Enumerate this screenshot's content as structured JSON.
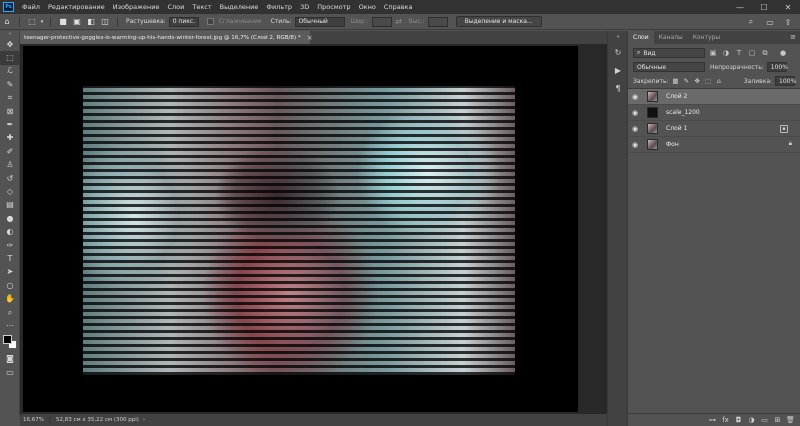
{
  "app": {
    "logo": "Ps"
  },
  "menu": {
    "items": [
      "Файл",
      "Редактирование",
      "Изображение",
      "Слои",
      "Текст",
      "Выделение",
      "Фильтр",
      "3D",
      "Просмотр",
      "Окно",
      "Справка"
    ]
  },
  "window_controls": {
    "minimize": "—",
    "maximize": "☐",
    "close": "✕"
  },
  "options": {
    "feather_label": "Растушевка:",
    "feather_value": "0 пикс.",
    "antialias_label": "Сглаживание",
    "style_label": "Стиль:",
    "style_value": "Обычный",
    "width_label": "Шир.:",
    "height_label": "Выс.:",
    "select_mask_button": "Выделение и маска..."
  },
  "document": {
    "tab_title": "teenager-protective-goggles-is-warming-up-his-hands-winter-forest.jpg @ 16,7% (Слой 2, RGB/8) *",
    "close": "×"
  },
  "status": {
    "zoom": "16,67%",
    "info": "52,83 см x 35,22 см (300 ppi)",
    "arrow": "›"
  },
  "layers_panel": {
    "tabs": [
      "Слои",
      "Каналы",
      "Контуры"
    ],
    "filter_value": "Вид",
    "blend_mode": "Обычные",
    "opacity_label": "Непрозрачность:",
    "opacity_value": "100%",
    "lock_label": "Закрепить:",
    "fill_label": "Заливка:",
    "fill_value": "100%",
    "layers": [
      {
        "name": "Слой 2",
        "selected": true
      },
      {
        "name": "scale_1200",
        "selected": false
      },
      {
        "name": "Слой 1",
        "selected": false
      },
      {
        "name": "Фон",
        "selected": false
      }
    ]
  },
  "tools": [
    "move-icon",
    "marquee-icon",
    "lasso-icon",
    "quick-select-icon",
    "crop-icon",
    "frame-icon",
    "eyedropper-icon",
    "healing-icon",
    "brush-icon",
    "stamp-icon",
    "history-brush-icon",
    "eraser-icon",
    "gradient-icon",
    "blur-icon",
    "dodge-icon",
    "pen-icon",
    "type-icon",
    "path-select-icon",
    "shape-icon",
    "hand-icon",
    "zoom-icon",
    "more-icon"
  ]
}
